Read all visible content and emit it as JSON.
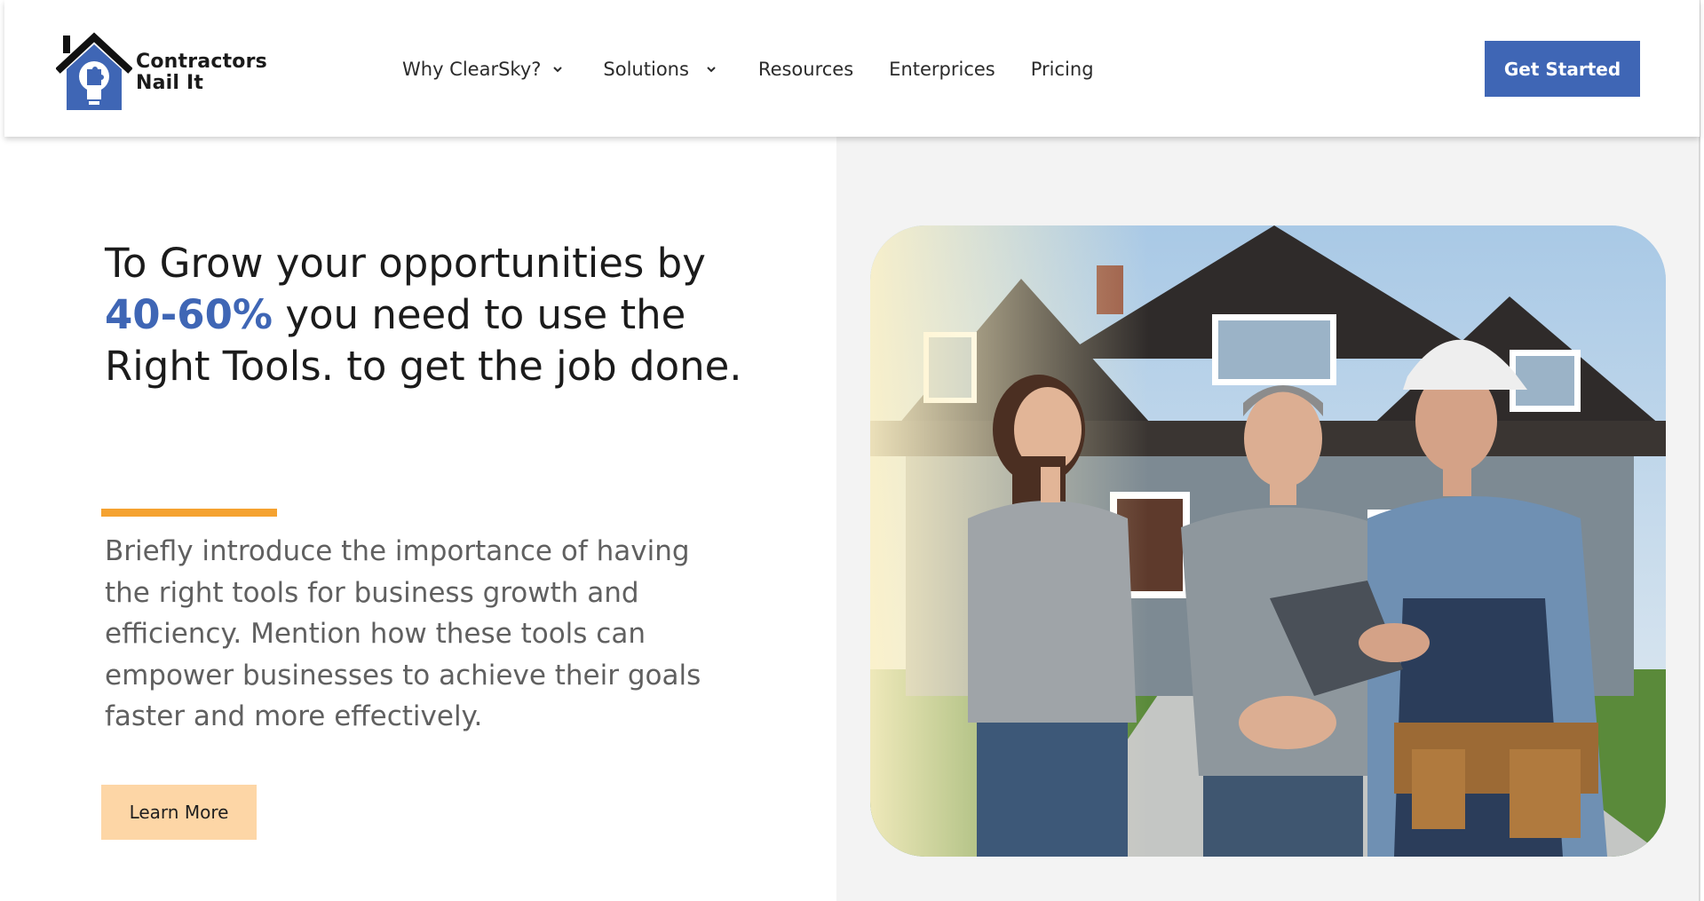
{
  "header": {
    "logo": {
      "line1": "Contractors",
      "line2": "Nail It",
      "icon": "house-lightbulb-logo-icon",
      "colors": {
        "roof": "#111111",
        "house": "#3f66b5"
      }
    },
    "nav": [
      {
        "label": "Why ClearSky?",
        "has_dropdown": true
      },
      {
        "label": "Solutions",
        "has_dropdown": true
      },
      {
        "label": "Resources",
        "has_dropdown": false
      },
      {
        "label": "Enterprices",
        "has_dropdown": false
      },
      {
        "label": "Pricing",
        "has_dropdown": false
      }
    ],
    "cta_label": "Get Started"
  },
  "hero": {
    "headline_part1": "To Grow your opportunities by",
    "headline_highlight": "40-60%",
    "headline_part2": "you need to use the Right Tools. to get the job done.",
    "intro": "Briefly introduce the importance of having the right tools for business growth and efficiency. Mention how these tools can empower businesses to achieve their goals faster and more effectively.",
    "button_label": "Learn More",
    "image_icon": "contractor-homeowners-photo"
  },
  "colors": {
    "brand_blue": "#3f66b5",
    "accent_orange": "#f5a230",
    "learn_more_bg": "#fdd6a6",
    "panel_gray": "#f3f3f3"
  }
}
